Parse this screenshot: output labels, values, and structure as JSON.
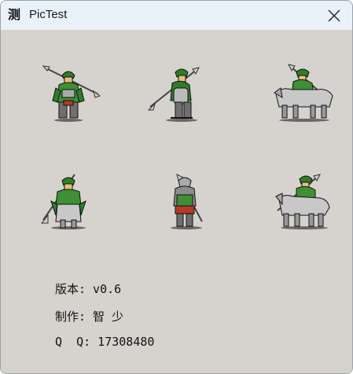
{
  "window": {
    "app_icon_char": "测",
    "title": "PicTest"
  },
  "sprites": [
    {
      "name": "warrior-front-standing",
      "color_armor": "#2f7d2a"
    },
    {
      "name": "warrior-side-spear",
      "color_armor": "#2f7d2a"
    },
    {
      "name": "warrior-on-horse-front",
      "color_armor": "#2f7d2a"
    },
    {
      "name": "warrior-on-horse-facing",
      "color_armor": "#2f7d2a"
    },
    {
      "name": "warrior-back-view",
      "color_armor": "#2f7d2a"
    },
    {
      "name": "warrior-on-horse-side",
      "color_armor": "#2f7d2a"
    }
  ],
  "info": {
    "version_line": "版本: v0.6",
    "author_line": "制作: 智 少",
    "qq_line": "Q  Q: 17308480"
  },
  "colors": {
    "title_bar": "#e8f2f8",
    "client_bg": "#d6d3ce",
    "armor_green": "#2f7d2a",
    "steel_grey": "#9a9a9a"
  }
}
